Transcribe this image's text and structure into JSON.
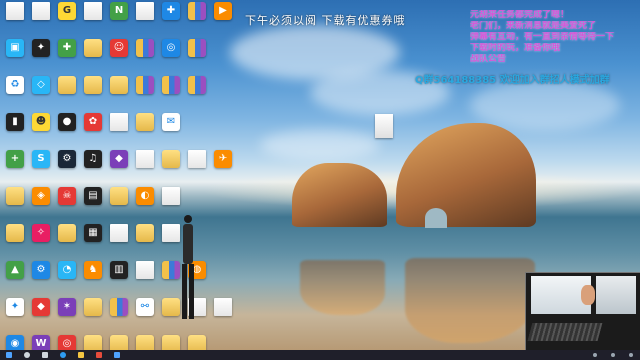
{
  "desktop": {
    "banner_text": "下午必须以阅 下载有优惠券哦",
    "notice_lines": [
      "元胡来任务都完成了嗯！",
      "老门们，来新消息就是美爱死了",
      "弹幕有互动，有一直到亲情等待一下",
      "下载时的玩，准备你哦",
      "战队公告"
    ],
    "qq_line": "Q群564188385 欢迎加入群招人模式加群",
    "icon_rows": [
      [
        {
          "label": "",
          "kind": "t-doc",
          "glyph": ""
        },
        {
          "label": "",
          "kind": "t-doc",
          "glyph": ""
        },
        {
          "label": "",
          "kind": "t-yellow",
          "glyph": "G"
        },
        {
          "label": "",
          "kind": "t-doc",
          "glyph": ""
        },
        {
          "label": "",
          "kind": "t-green",
          "glyph": "N"
        },
        {
          "label": "",
          "kind": "t-doc",
          "glyph": ""
        },
        {
          "label": "",
          "kind": "t-blue",
          "glyph": "✚"
        },
        {
          "label": "",
          "kind": "t-zip",
          "glyph": ""
        },
        {
          "label": "",
          "kind": "t-orange",
          "glyph": "▶"
        }
      ],
      [
        {
          "label": "",
          "kind": "t-cyan",
          "glyph": "▣"
        },
        {
          "label": "",
          "kind": "t-dark",
          "glyph": "✦"
        },
        {
          "label": "",
          "kind": "t-green",
          "glyph": "✚"
        },
        {
          "label": "",
          "kind": "t-folder",
          "glyph": ""
        },
        {
          "label": "",
          "kind": "t-red",
          "glyph": "☺"
        },
        {
          "label": "",
          "kind": "t-zip",
          "glyph": ""
        },
        {
          "label": "",
          "kind": "t-blue",
          "glyph": "◎"
        },
        {
          "label": "",
          "kind": "t-zip",
          "glyph": ""
        }
      ],
      [
        {
          "label": "",
          "kind": "t-white",
          "glyph": "♻"
        },
        {
          "label": "",
          "kind": "t-cyan",
          "glyph": "◇"
        },
        {
          "label": "",
          "kind": "t-folder",
          "glyph": ""
        },
        {
          "label": "",
          "kind": "t-folder",
          "glyph": ""
        },
        {
          "label": "",
          "kind": "t-folder",
          "glyph": ""
        },
        {
          "label": "",
          "kind": "t-zip",
          "glyph": ""
        },
        {
          "label": "",
          "kind": "t-zip",
          "glyph": ""
        },
        {
          "label": "",
          "kind": "t-zip",
          "glyph": ""
        }
      ],
      [
        {
          "label": "",
          "kind": "t-dark",
          "glyph": "▮"
        },
        {
          "label": "",
          "kind": "t-yellow",
          "glyph": "☻"
        },
        {
          "label": "",
          "kind": "t-dark",
          "glyph": "●"
        },
        {
          "label": "",
          "kind": "t-red",
          "glyph": "✿"
        },
        {
          "label": "",
          "kind": "t-doc",
          "glyph": ""
        },
        {
          "label": "",
          "kind": "t-folder",
          "glyph": ""
        },
        {
          "label": "",
          "kind": "t-white",
          "glyph": "✉"
        }
      ],
      [
        {
          "label": "",
          "kind": "t-green",
          "glyph": "+"
        },
        {
          "label": "",
          "kind": "t-cyan",
          "glyph": "S"
        },
        {
          "label": "",
          "kind": "t-steam",
          "glyph": "⚙"
        },
        {
          "label": "",
          "kind": "t-dark",
          "glyph": "♫"
        },
        {
          "label": "",
          "kind": "t-purple",
          "glyph": "◆"
        },
        {
          "label": "",
          "kind": "t-doc",
          "glyph": ""
        },
        {
          "label": "",
          "kind": "t-folder",
          "glyph": ""
        },
        {
          "label": "",
          "kind": "t-doc",
          "glyph": ""
        },
        {
          "label": "",
          "kind": "t-orange",
          "glyph": "✈"
        }
      ],
      [
        {
          "label": "",
          "kind": "t-folder",
          "glyph": ""
        },
        {
          "label": "",
          "kind": "t-orange",
          "glyph": "◈"
        },
        {
          "label": "",
          "kind": "t-red",
          "glyph": "☠"
        },
        {
          "label": "",
          "kind": "t-dark",
          "glyph": "▤"
        },
        {
          "label": "",
          "kind": "t-folder",
          "glyph": ""
        },
        {
          "label": "",
          "kind": "t-orange",
          "glyph": "◐"
        },
        {
          "label": "",
          "kind": "t-doc",
          "glyph": ""
        }
      ],
      [
        {
          "label": "",
          "kind": "t-folder",
          "glyph": ""
        },
        {
          "label": "",
          "kind": "t-pink",
          "glyph": "✧"
        },
        {
          "label": "",
          "kind": "t-folder",
          "glyph": ""
        },
        {
          "label": "",
          "kind": "t-dark",
          "glyph": "▦"
        },
        {
          "label": "",
          "kind": "t-doc",
          "glyph": ""
        },
        {
          "label": "",
          "kind": "t-folder",
          "glyph": ""
        },
        {
          "label": "",
          "kind": "t-doc",
          "glyph": ""
        }
      ],
      [
        {
          "label": "",
          "kind": "t-green",
          "glyph": "▲"
        },
        {
          "label": "",
          "kind": "t-blue",
          "glyph": "⚙"
        },
        {
          "label": "",
          "kind": "t-cyan",
          "glyph": "◔"
        },
        {
          "label": "",
          "kind": "t-orange",
          "glyph": "♞"
        },
        {
          "label": "",
          "kind": "t-dark",
          "glyph": "▥"
        },
        {
          "label": "",
          "kind": "t-doc",
          "glyph": ""
        },
        {
          "label": "",
          "kind": "t-zip",
          "glyph": ""
        },
        {
          "label": "",
          "kind": "t-orange",
          "glyph": "◍"
        }
      ],
      [
        {
          "label": "",
          "kind": "t-white",
          "glyph": "✦"
        },
        {
          "label": "",
          "kind": "t-red",
          "glyph": "◆"
        },
        {
          "label": "",
          "kind": "t-purple",
          "glyph": "✶"
        },
        {
          "label": "",
          "kind": "t-folder",
          "glyph": ""
        },
        {
          "label": "",
          "kind": "t-zip",
          "glyph": ""
        },
        {
          "label": "",
          "kind": "t-white",
          "glyph": "⚯"
        },
        {
          "label": "",
          "kind": "t-folder",
          "glyph": ""
        },
        {
          "label": "",
          "kind": "t-doc",
          "glyph": ""
        },
        {
          "label": "",
          "kind": "t-doc",
          "glyph": ""
        }
      ],
      [
        {
          "label": "",
          "kind": "t-blue",
          "glyph": "◉"
        },
        {
          "label": "",
          "kind": "t-purple",
          "glyph": "W"
        },
        {
          "label": "",
          "kind": "t-red",
          "glyph": "◎"
        },
        {
          "label": "",
          "kind": "t-folder",
          "glyph": ""
        },
        {
          "label": "",
          "kind": "t-folder",
          "glyph": ""
        },
        {
          "label": "",
          "kind": "t-folder",
          "glyph": ""
        },
        {
          "label": "",
          "kind": "t-folder",
          "glyph": ""
        },
        {
          "label": "",
          "kind": "t-folder",
          "glyph": ""
        }
      ]
    ]
  },
  "taskbar": {
    "items": [
      "start",
      "search",
      "task-view",
      "browser",
      "explorer",
      "media",
      "store"
    ]
  }
}
